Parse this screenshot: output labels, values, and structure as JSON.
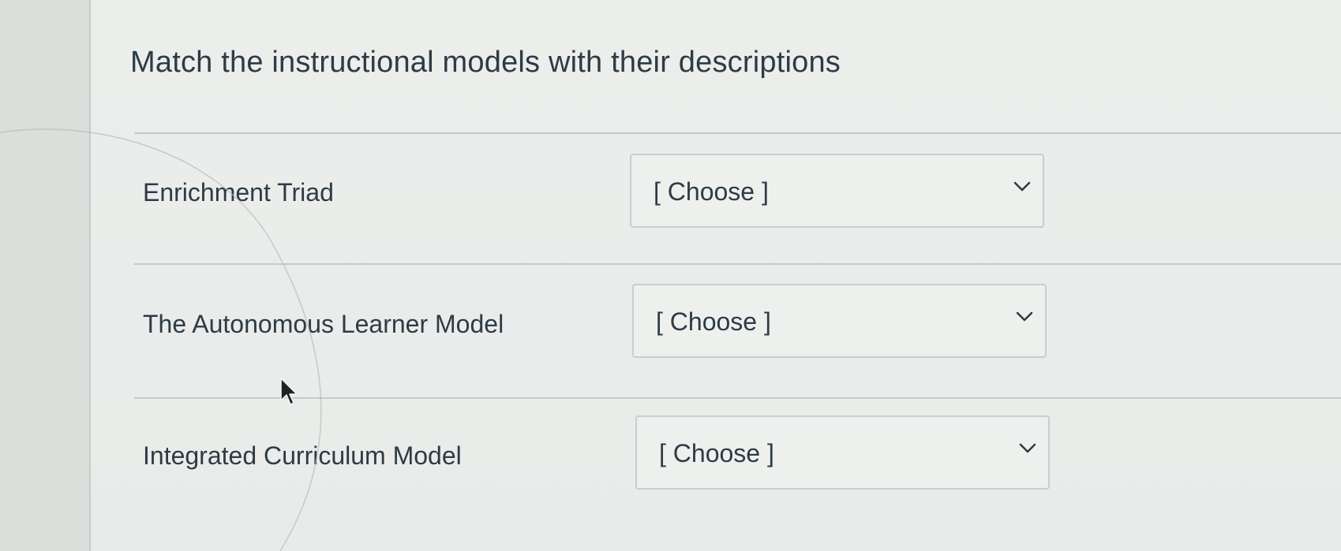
{
  "question": {
    "text": "Match the instructional models with their descriptions"
  },
  "rows": [
    {
      "label": "Enrichment Triad",
      "selected": "[ Choose ]"
    },
    {
      "label": "The Autonomous Learner Model",
      "selected": "[ Choose ]"
    },
    {
      "label": "Integrated Curriculum Model",
      "selected": "[ Choose ]"
    }
  ],
  "colors": {
    "text": "#2d3b45",
    "border": "#c7cdd1",
    "background": "#eceeec"
  },
  "icons": {
    "dropdown": "chevron-down-icon",
    "cursor": "mouse-pointer-icon"
  }
}
